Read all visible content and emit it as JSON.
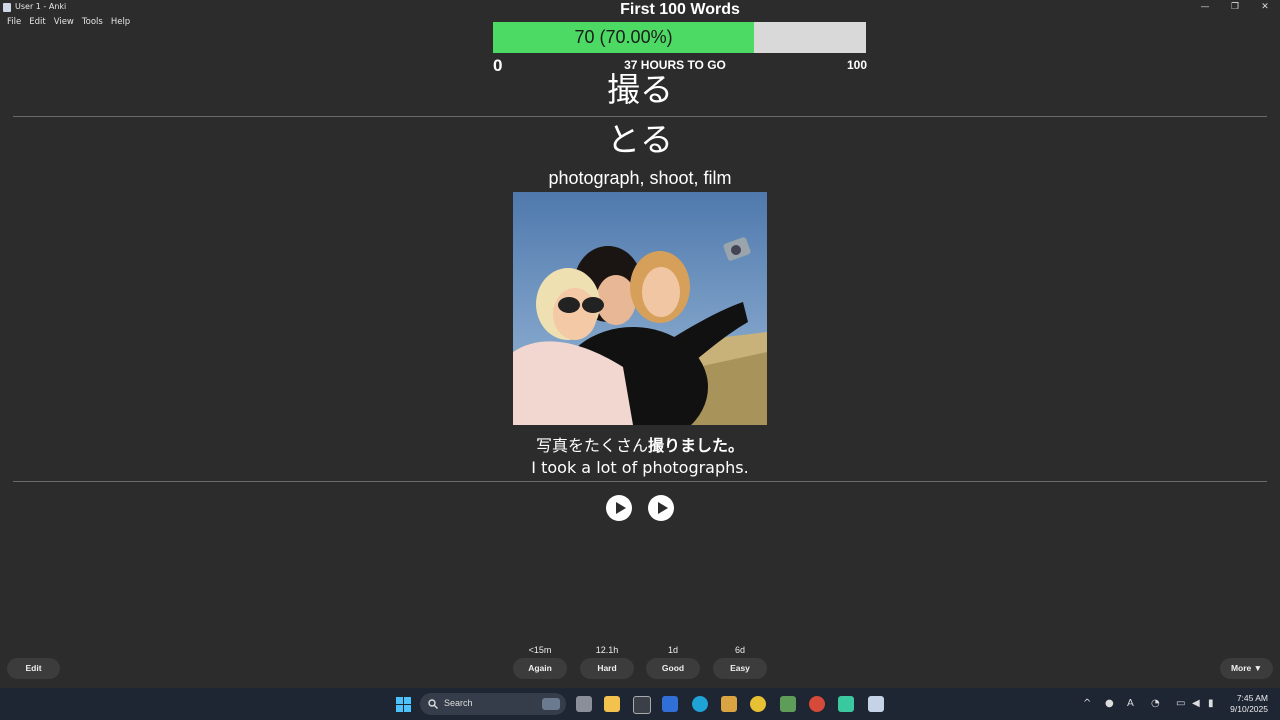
{
  "window": {
    "title": "User 1 - Anki",
    "controls": {
      "minimize": "—",
      "restore": "❐",
      "close": "✕"
    }
  },
  "menu": [
    "File",
    "Edit",
    "View",
    "Tools",
    "Help"
  ],
  "deck": {
    "title": "First 100 Words",
    "progress_label": "70 (70.00%)",
    "progress_fraction": 0.7,
    "range_min": "0",
    "range_max": "100",
    "time_left": "37 HOURS TO GO"
  },
  "card": {
    "word": "撮る",
    "reading": "とる",
    "meaning": "photograph, shoot, film",
    "sentence_jp_plain": "写真をたくさん",
    "sentence_jp_bold": "撮りました。",
    "sentence_en": "I took a lot of photographs."
  },
  "answers": [
    {
      "interval": "<15m",
      "label": "Again"
    },
    {
      "interval": "12.1h",
      "label": "Hard"
    },
    {
      "interval": "1d",
      "label": "Good"
    },
    {
      "interval": "6d",
      "label": "Easy"
    }
  ],
  "footer": {
    "edit_label": "Edit",
    "more_label": "More ▼"
  },
  "taskbar": {
    "search_label": "Search",
    "time": "7:45 AM",
    "date": "9/10/2025"
  }
}
